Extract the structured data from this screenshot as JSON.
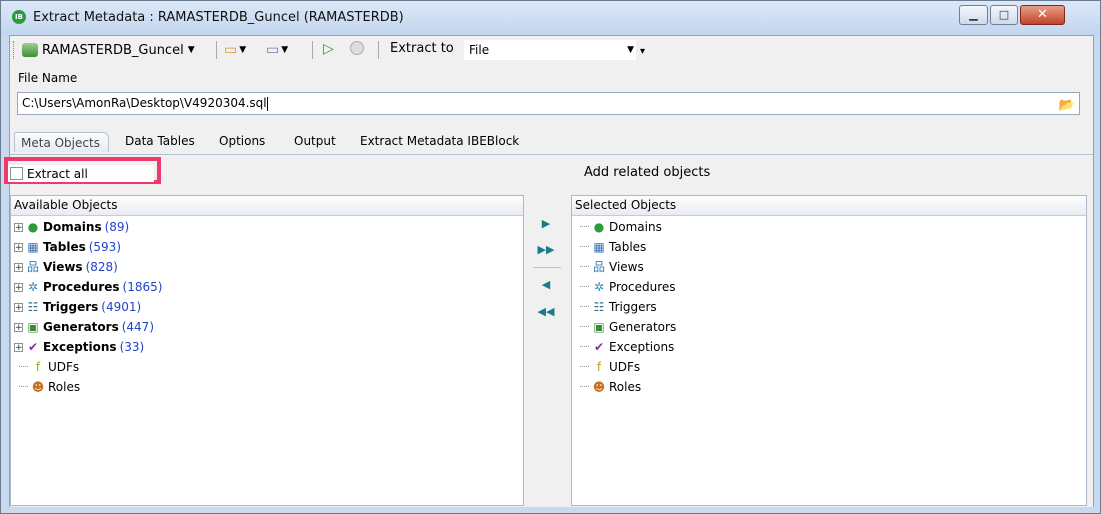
{
  "window": {
    "title": "Extract Metadata : RAMASTERDB_Guncel (RAMASTERDB)",
    "app_icon": "IB",
    "minimize_glyph": "▁",
    "maximize_glyph": "□",
    "close_glyph": "✕"
  },
  "toolbar": {
    "database": "RAMASTERDB_Guncel",
    "extract_to_label": "Extract to",
    "extract_to_value": "File"
  },
  "file": {
    "label": "File Name",
    "value": "C:\\Users\\AmonRa\\Desktop\\V4920304.sql"
  },
  "tabs": [
    "Meta Objects",
    "Data Tables",
    "Options",
    "Output",
    "Extract Metadata IBEBlock"
  ],
  "extract_all_label": "Extract all",
  "add_related_label": "Add related objects",
  "available": {
    "header": "Available Objects",
    "items": [
      {
        "label": "Domains",
        "count": "(89)",
        "icon": "domain-icon"
      },
      {
        "label": "Tables",
        "count": "(593)",
        "icon": "table-icon"
      },
      {
        "label": "Views",
        "count": "(828)",
        "icon": "view-icon"
      },
      {
        "label": "Procedures",
        "count": "(1865)",
        "icon": "procedure-icon"
      },
      {
        "label": "Triggers",
        "count": "(4901)",
        "icon": "trigger-icon"
      },
      {
        "label": "Generators",
        "count": "(447)",
        "icon": "generator-icon"
      },
      {
        "label": "Exceptions",
        "count": "(33)",
        "icon": "exception-icon"
      },
      {
        "label": "UDFs",
        "count": "",
        "icon": "udf-icon"
      },
      {
        "label": "Roles",
        "count": "",
        "icon": "role-icon"
      }
    ]
  },
  "selected": {
    "header": "Selected Objects",
    "items": [
      "Domains",
      "Tables",
      "Views",
      "Procedures",
      "Triggers",
      "Generators",
      "Exceptions",
      "UDFs",
      "Roles"
    ]
  },
  "arrows": [
    "▶",
    "▶▶",
    "◀",
    "◀◀"
  ],
  "colors": {
    "highlight": "#f0386a",
    "count": "#2244cc",
    "arrow": "#1a7a8a"
  }
}
